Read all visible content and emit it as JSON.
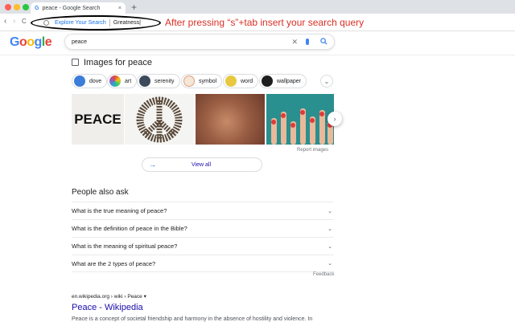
{
  "browser": {
    "tab_title": "peace - Google Search",
    "tab_close": "×",
    "new_tab": "+",
    "back": "‹",
    "forward": "›",
    "reload": "C",
    "omnibox_keyword": "Explore Your Search",
    "omnibox_text": "Greatness|"
  },
  "annotation": "After pressing “s”+tab insert your search query",
  "google": {
    "logo": [
      "G",
      "o",
      "o",
      "g",
      "l",
      "e"
    ],
    "logo_colors": [
      "#4285f4",
      "#ea4335",
      "#fbbc05",
      "#4285f4",
      "#34a853",
      "#ea4335"
    ],
    "query": "peace",
    "clear_icon": "✕",
    "search_icon": "⚲"
  },
  "images": {
    "title": "Images for peace",
    "chips": [
      {
        "label": "dove",
        "color": "#3b7dd8"
      },
      {
        "label": "art",
        "color": "#c0392b"
      },
      {
        "label": "serenity",
        "color": "#3d4a5c"
      },
      {
        "label": "symbol",
        "color": "#d9a07a"
      },
      {
        "label": "word",
        "color": "#e8c840"
      },
      {
        "label": "wallpaper",
        "color": "#1e1e1e"
      }
    ],
    "thumbs": [
      {
        "text": "PEACE",
        "bg": "#f0eeea"
      },
      {
        "text": "",
        "bg": "#f4f4f2"
      },
      {
        "text": "",
        "bg": "#8a5a42"
      },
      {
        "text": "",
        "bg": "#2a8f8f"
      }
    ],
    "report": "Report images",
    "view_all": "View all",
    "arrow": "→",
    "next": "›",
    "more": "⌄"
  },
  "paa": {
    "title": "People also ask",
    "questions": [
      "What is the true meaning of peace?",
      "What is the definition of peace in the Bible?",
      "What is the meaning of spiritual peace?",
      "What are the 2 types of peace?"
    ],
    "chevron": "⌄",
    "feedback": "Feedback"
  },
  "result": {
    "cite": "en.wikipedia.org › wiki › Peace ▾",
    "title": "Peace - Wikipedia",
    "snippet": "Peace is a concept of societal friendship and harmony in the absence of hostility and violence. In"
  }
}
